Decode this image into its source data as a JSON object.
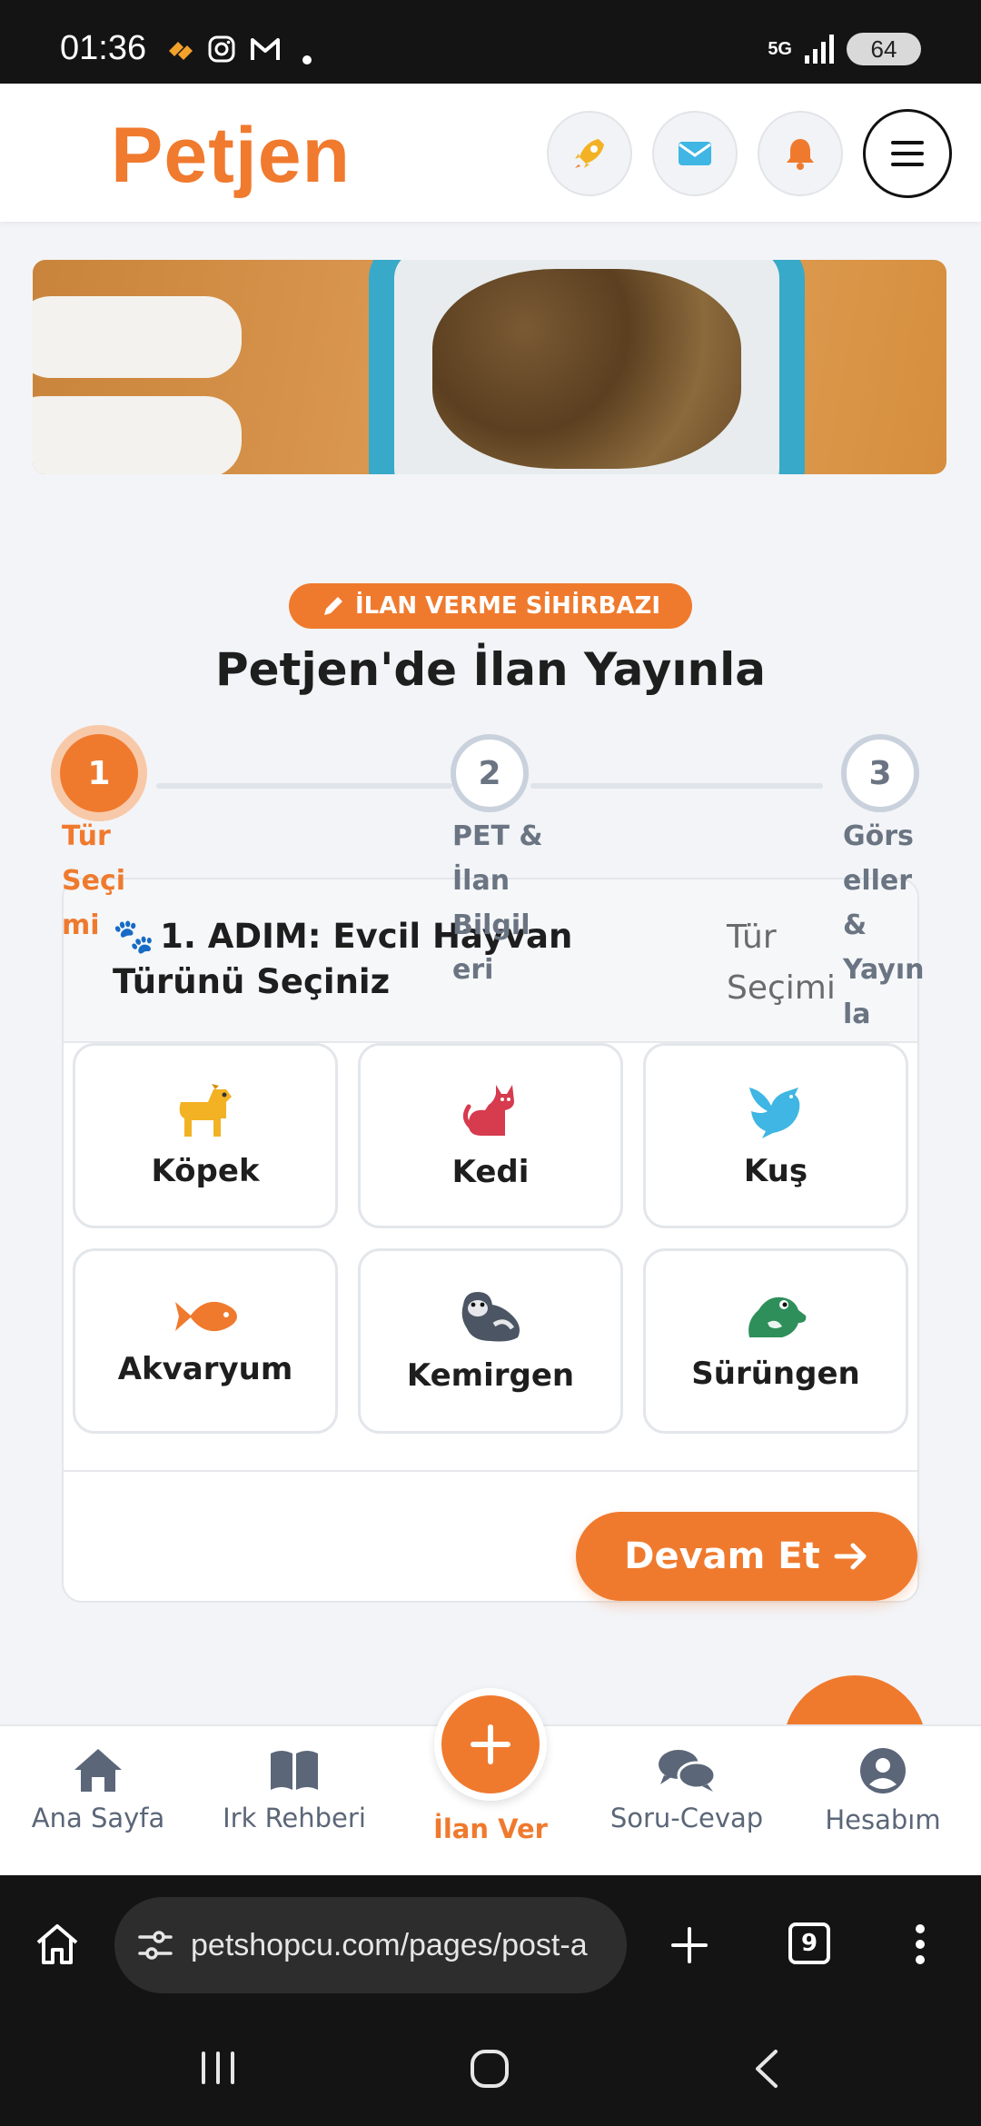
{
  "status_bar": {
    "time": "01:36",
    "network": "5G",
    "battery": "64"
  },
  "header": {
    "logo": "Petjen"
  },
  "wizard": {
    "badge": "İLAN VERME SİHİRBAZI",
    "title": "Petjen'de İlan Yayınla",
    "steps": [
      {
        "number": "1",
        "label_lines": [
          "Tür",
          "Seçi",
          "mi"
        ]
      },
      {
        "number": "2",
        "label_lines": [
          "PET &",
          "İlan",
          "Bilgil",
          "eri"
        ]
      },
      {
        "number": "3",
        "label_lines": [
          "Görs",
          "eller",
          "&",
          "Yayın",
          "la"
        ]
      }
    ]
  },
  "card": {
    "title": "1. ADIM: Evcil Hayvan Türünü Seçiniz",
    "subtitle": "Tür Seçimi",
    "pets": [
      "Köpek",
      "Kedi",
      "Kuş",
      "Akvaryum",
      "Kemirgen",
      "Sürüngen"
    ],
    "continue_label": "Devam Et"
  },
  "bottom_nav": {
    "home": "Ana Sayfa",
    "breeds": "Irk Rehberi",
    "post": "İlan Ver",
    "qa": "Soru-Cevap",
    "account": "Hesabım"
  },
  "browser": {
    "url": "petshopcu.com/pages/post-a",
    "tab_count": "9"
  },
  "colors": {
    "accent": "#ef7a2e",
    "dark": "#141414",
    "muted": "#5b6678"
  }
}
